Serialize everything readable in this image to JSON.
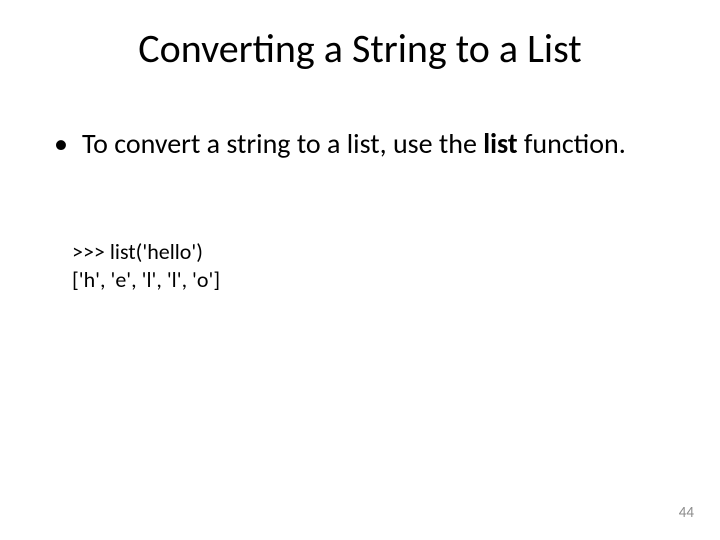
{
  "title": "Converting a String to a List",
  "bullet": {
    "prefix": "To convert a string to a list, use the ",
    "bold": "list",
    "suffix": " function."
  },
  "code": {
    "line1": ">>> list('hello')",
    "line2": "['h', 'e', 'l', 'l', 'o']"
  },
  "page_number": "44"
}
